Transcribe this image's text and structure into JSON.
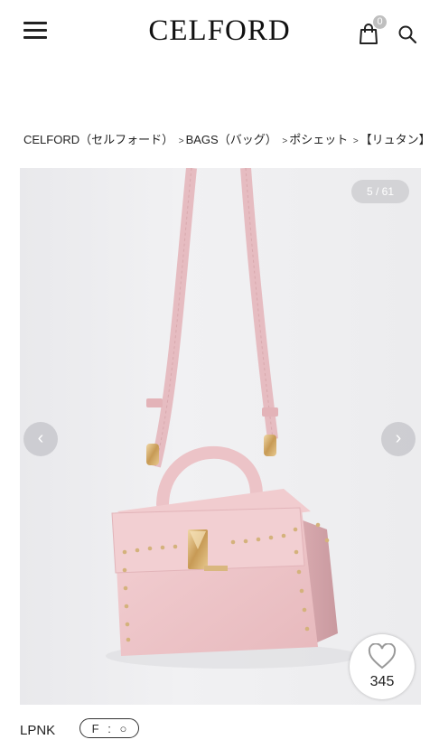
{
  "header": {
    "logo": "CELFORD",
    "cart_count": "0"
  },
  "breadcrumb": {
    "items": [
      "CELFORD（セルフォード）",
      "BAGS（バッグ）",
      "ポシェット",
      "【リュタン】"
    ],
    "separator": ">"
  },
  "gallery": {
    "counter": "5 / 61",
    "likes": "345"
  },
  "product": {
    "color_code": "LPNK",
    "fit_label": "F : ○"
  },
  "colors": {
    "bag_pink": "#eec7cb",
    "hardware_gold": "#d7b37a",
    "background": "#ececee"
  }
}
